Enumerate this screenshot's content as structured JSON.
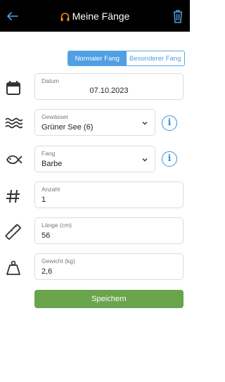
{
  "header": {
    "title": "Meine Fänge",
    "back_icon": "arrow-left-icon",
    "title_icon": "headphones-icon",
    "delete_icon": "trash-icon",
    "accent": "#4f9fe4",
    "title_icon_color": "#f08a24"
  },
  "segment": {
    "normal_label": "Normaler Fang",
    "special_label": "Besonderer Fang",
    "selected": "Normaler Fang"
  },
  "form": {
    "date": {
      "label": "Datum",
      "value": "07.10.2023"
    },
    "water": {
      "label": "Gewässer",
      "value": "Grüner See (6)"
    },
    "fish": {
      "label": "Fang",
      "value": "Barbe"
    },
    "count": {
      "label": "Anzahl",
      "value": "1"
    },
    "length": {
      "label": "Länge (cm)",
      "value": "56"
    },
    "weight": {
      "label": "Gewicht (kg)",
      "value": "2,6"
    }
  },
  "save_label": "Speichern",
  "save_color": "#6aa44c"
}
